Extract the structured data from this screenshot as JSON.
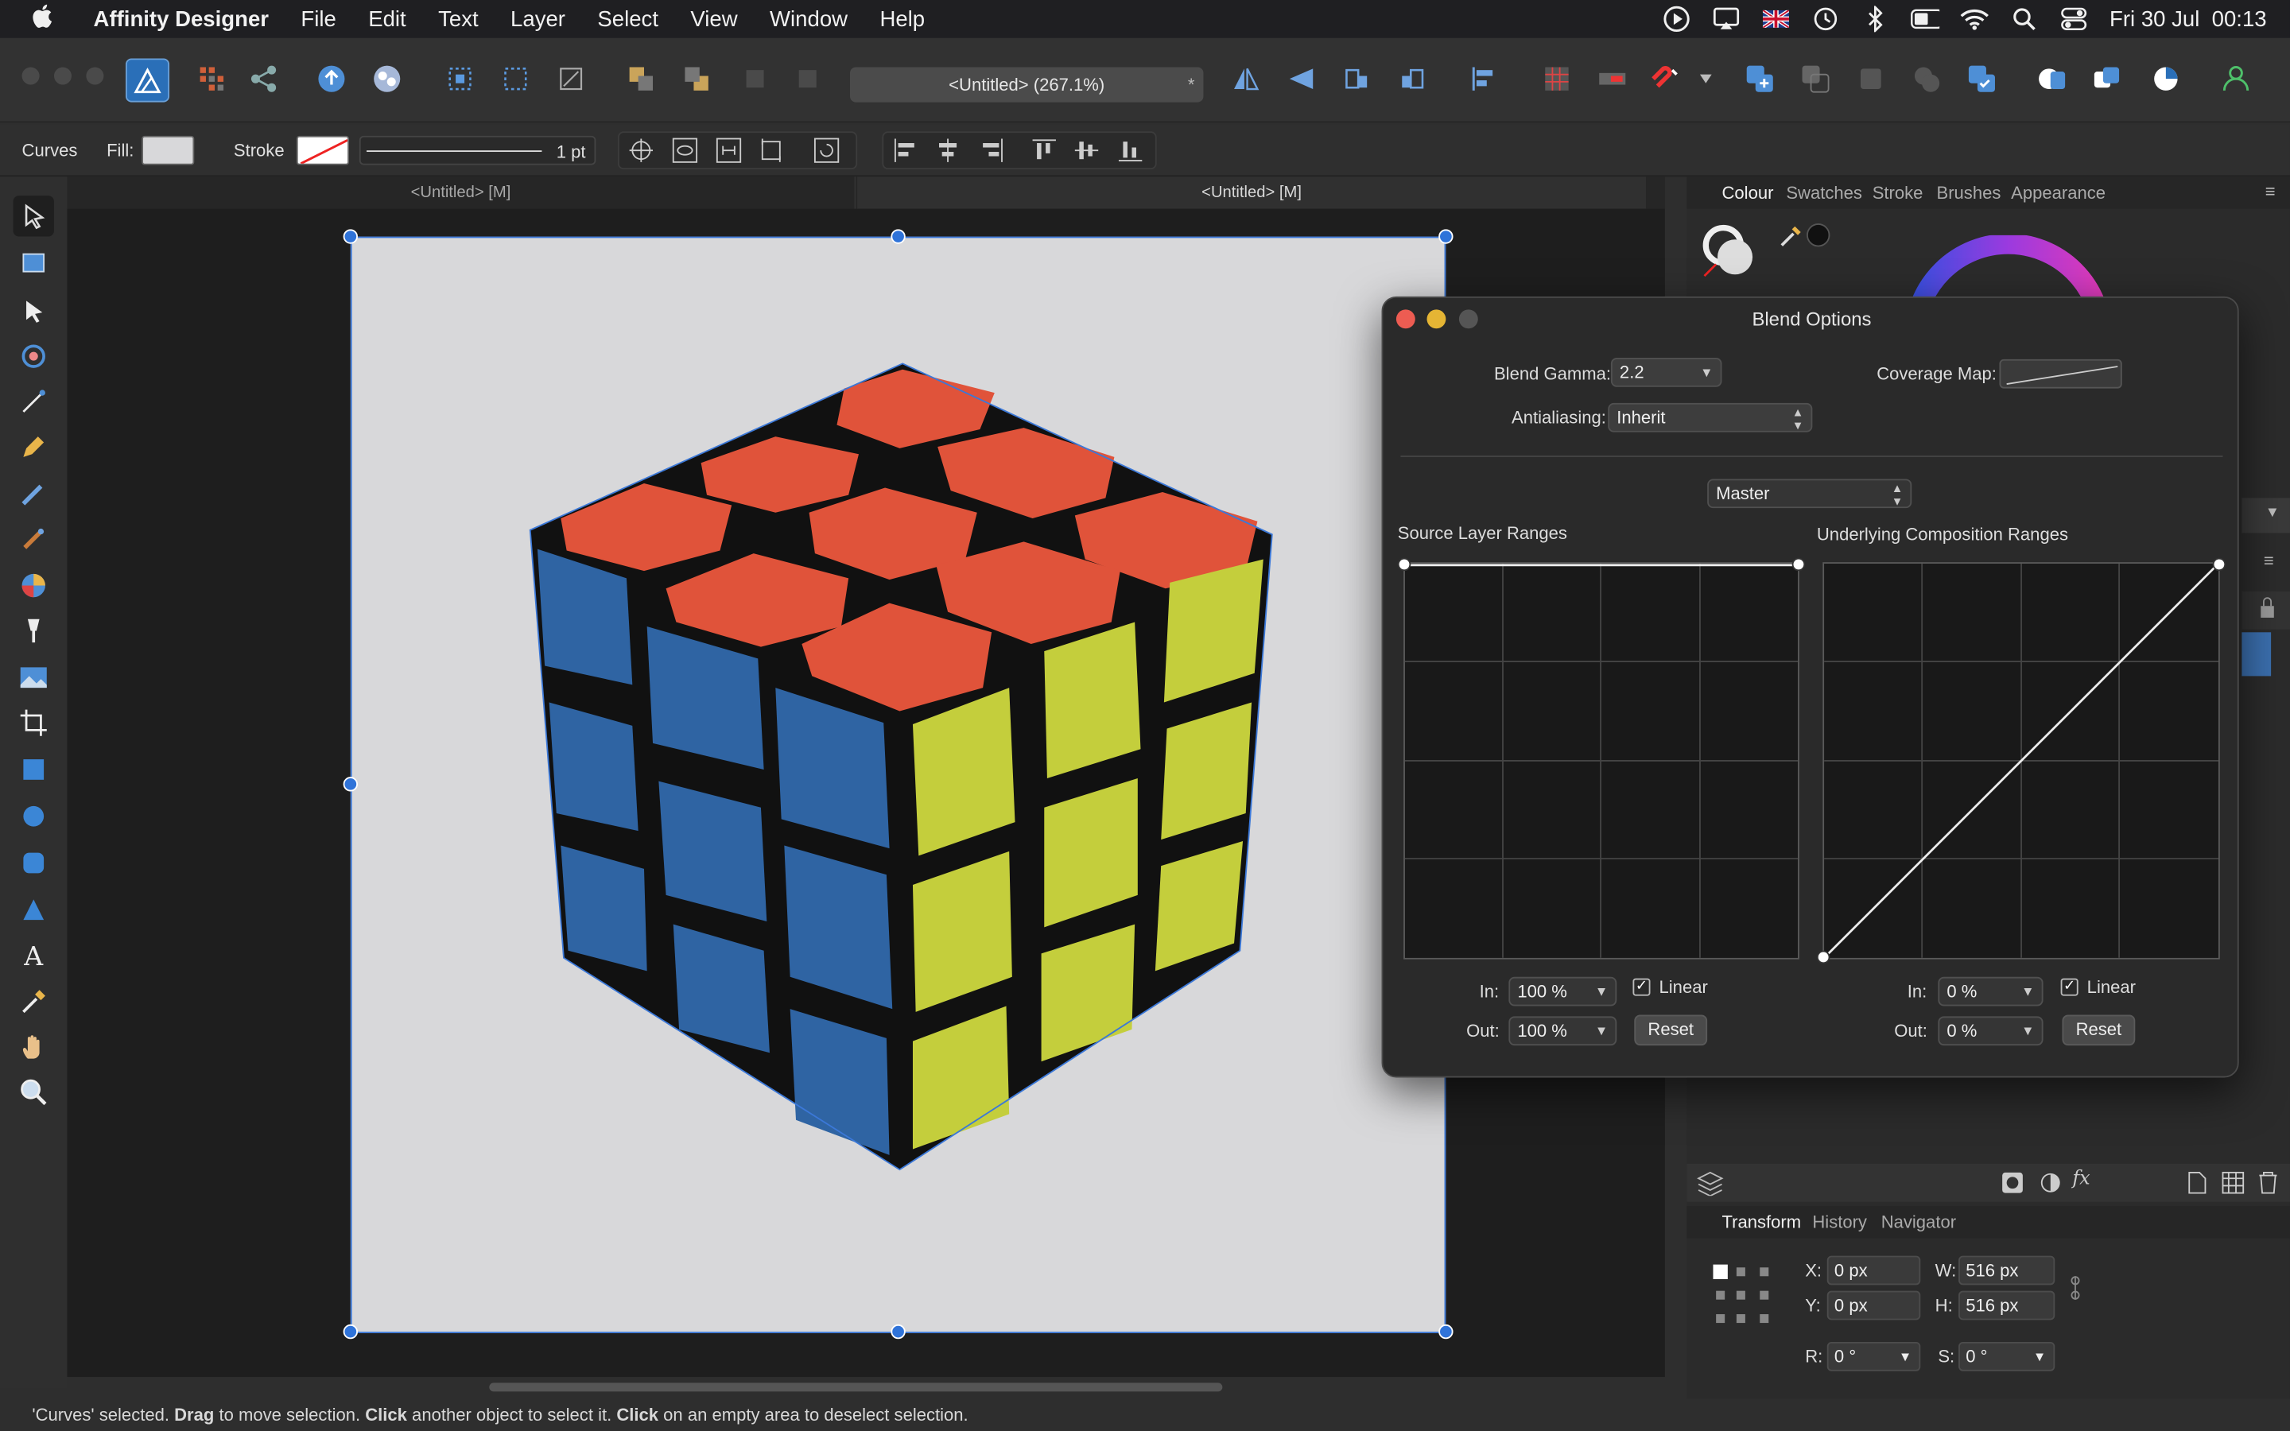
{
  "menubar": {
    "apple": "",
    "app_name": "Affinity Designer",
    "items": [
      "File",
      "Edit",
      "Text",
      "Layer",
      "Select",
      "View",
      "Window",
      "Help"
    ],
    "clock": "Fri 30 Jul  00:13"
  },
  "toolbar": {
    "document_title": "<Untitled> (267.1%)",
    "document_close": "*"
  },
  "context": {
    "layer_type": "Curves",
    "fill_label": "Fill:",
    "stroke_label": "Stroke",
    "stroke_width": "1 pt"
  },
  "tabs": [
    "<Untitled> [M]",
    "<Untitled> [M]"
  ],
  "right_panel": {
    "tabs": [
      "Colour",
      "Swatches",
      "Stroke",
      "Brushes",
      "Appearance"
    ],
    "bottom_tabs": [
      "Transform",
      "History",
      "Navigator"
    ],
    "transform": {
      "x_label": "X:",
      "x": "0 px",
      "y_label": "Y:",
      "y": "0 px",
      "w_label": "W:",
      "w": "516 px",
      "h_label": "H:",
      "h": "516 px",
      "r_label": "R:",
      "r": "0 °",
      "s_label": "S:",
      "s": "0 °"
    }
  },
  "dialog": {
    "title": "Blend Options",
    "blend_gamma_label": "Blend Gamma:",
    "blend_gamma": "2.2",
    "coverage_map_label": "Coverage Map:",
    "antialiasing_label": "Antialiasing:",
    "antialiasing": "Inherit",
    "channel": "Master",
    "source": {
      "title": "Source Layer Ranges",
      "in_label": "In:",
      "in": "100 %",
      "out_label": "Out:",
      "out": "100 %",
      "linear": "Linear",
      "reset": "Reset"
    },
    "underlying": {
      "title": "Underlying Composition Ranges",
      "in_label": "In:",
      "in": "0 %",
      "out_label": "Out:",
      "out": "0 %",
      "linear": "Linear",
      "reset": "Reset"
    }
  },
  "status": {
    "parts": [
      "'Curves' selected. ",
      "Drag",
      " to move selection. ",
      "Click",
      " another object to select it. ",
      "Click",
      " on an empty area to deselect selection."
    ]
  },
  "colors": {
    "accent": "#2f73d9",
    "cube_red": "#e0533a",
    "cube_blue": "#2f64a3",
    "cube_yellow": "#c4ce3c"
  }
}
